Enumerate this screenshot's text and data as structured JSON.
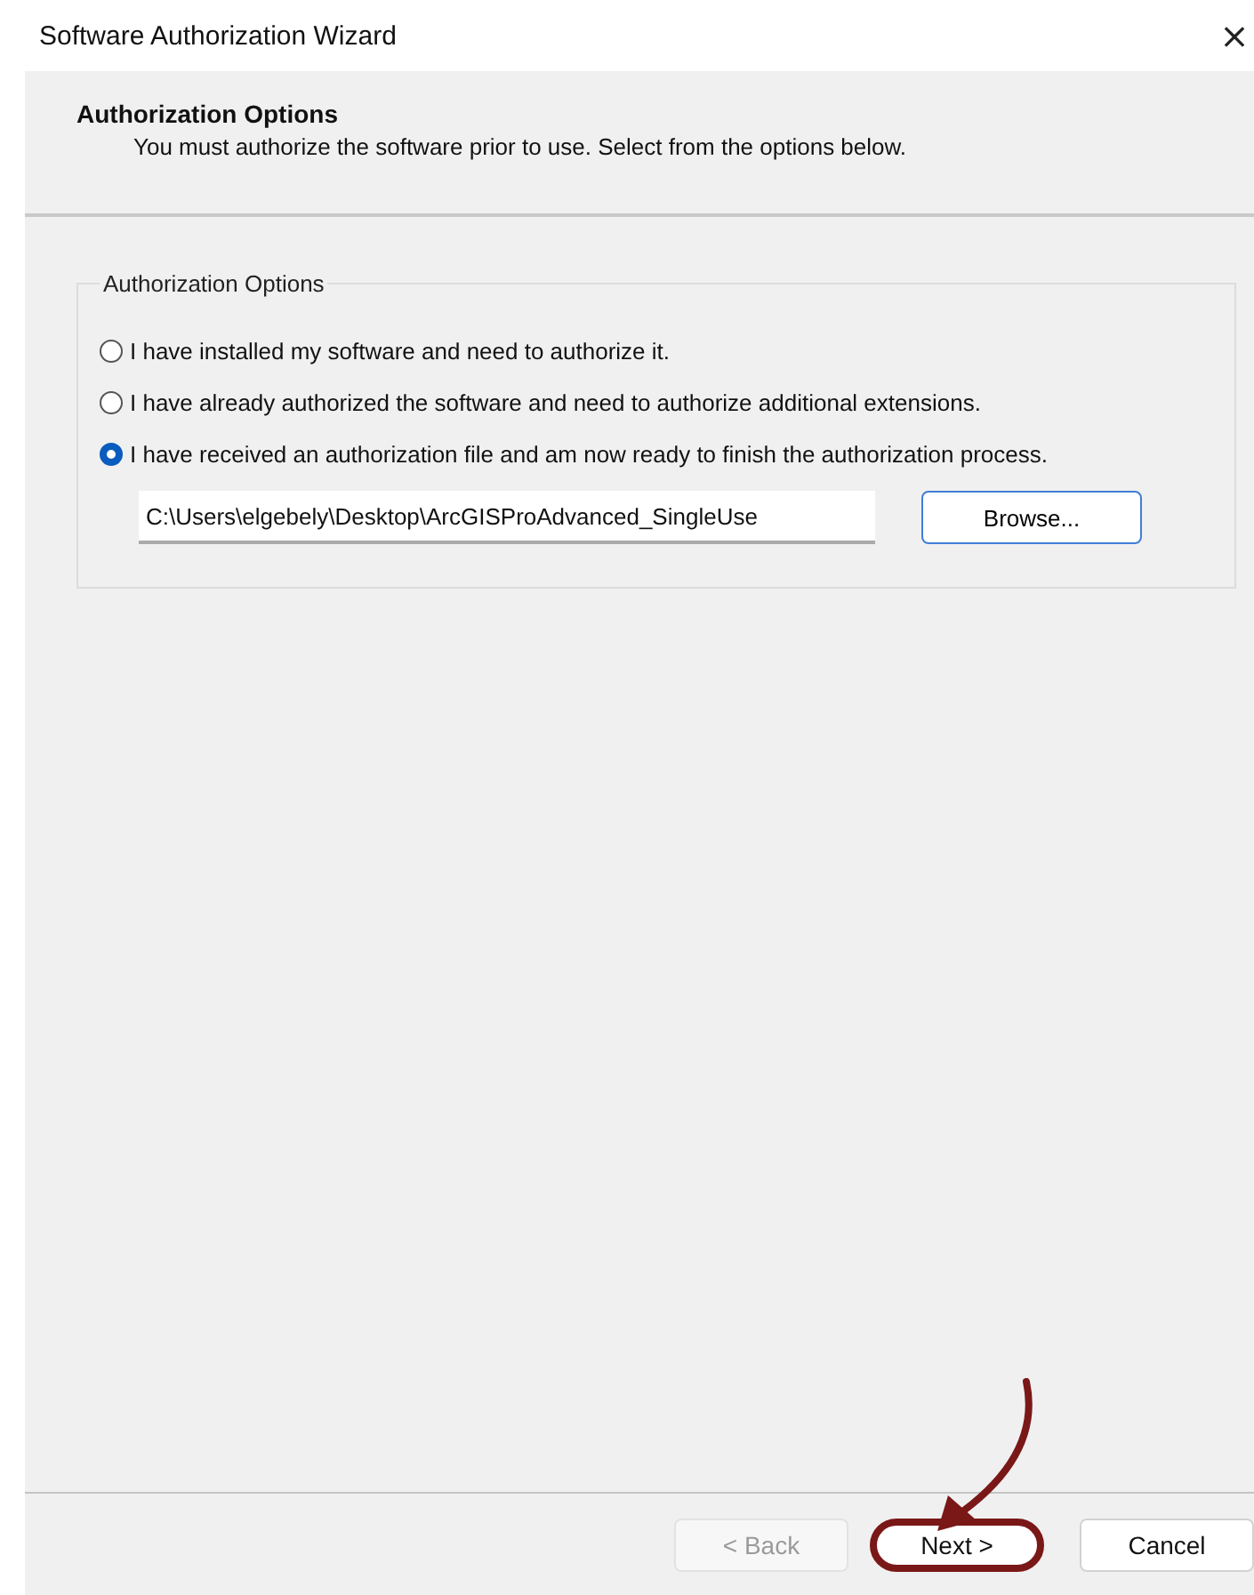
{
  "window": {
    "title": "Software Authorization Wizard",
    "close": "×"
  },
  "header": {
    "title": "Authorization Options",
    "subtitle": "You must authorize the software prior to use. Select from the options below."
  },
  "group": {
    "legend": "Authorization Options",
    "options": [
      {
        "label": "I have installed my software and need to authorize it.",
        "selected": false
      },
      {
        "label": "I have already authorized the software and need to authorize additional extensions.",
        "selected": false
      },
      {
        "label": "I have received an authorization file and am now ready to finish the authorization process.",
        "selected": true
      }
    ],
    "file_path": {
      "value": "C:\\Users\\elgebely\\Desktop\\ArcGISProAdvanced_SingleUse"
    },
    "browse_button": "Browse..."
  },
  "buttons": [
    {
      "label": "< Back",
      "disabled": true,
      "highlighted": false
    },
    {
      "label": "Next >",
      "disabled": false,
      "highlighted": true
    },
    {
      "label": "Cancel",
      "disabled": false,
      "highlighted": false
    }
  ]
}
